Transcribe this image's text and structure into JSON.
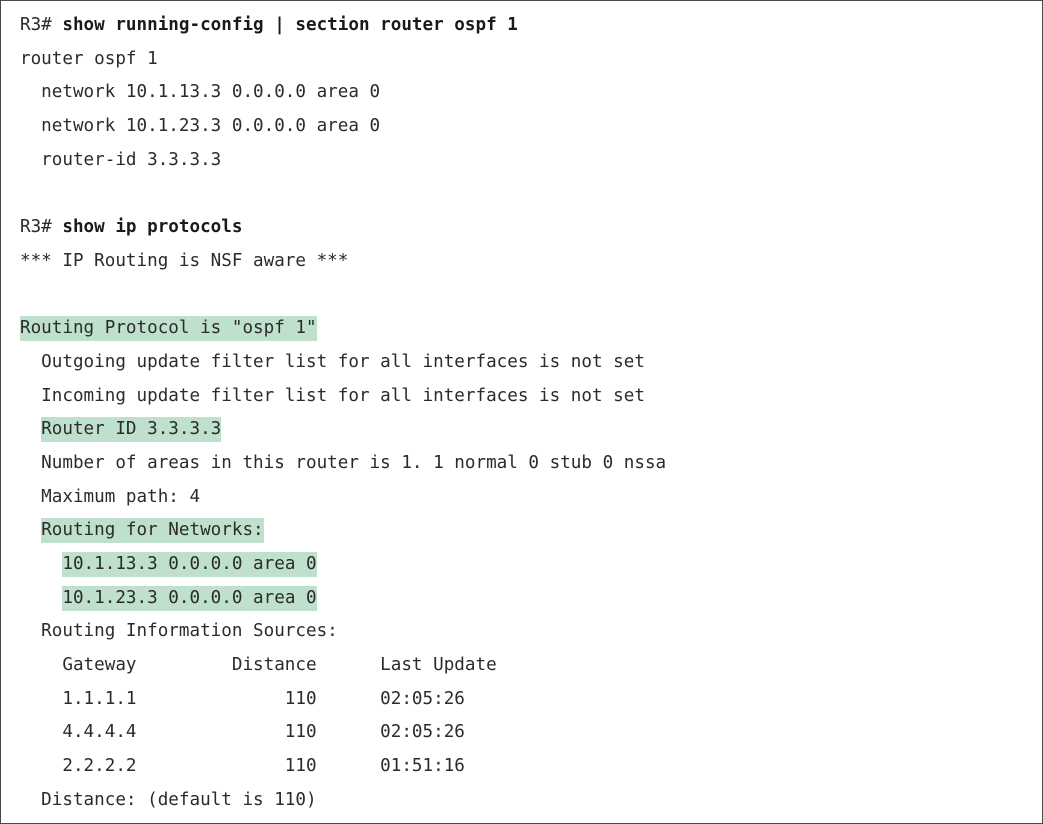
{
  "block1": {
    "prompt": "R3# ",
    "command": "show running-config | section router ospf 1",
    "lines": [
      "router ospf 1",
      "  network 10.1.13.3 0.0.0.0 area 0",
      "  network 10.1.23.3 0.0.0.0 area 0",
      "  router-id 3.3.3.3"
    ]
  },
  "block2": {
    "prompt": "R3# ",
    "command": "show ip protocols",
    "nsf_line": "*** IP Routing is NSF aware ***",
    "routing_protocol": "Routing Protocol is \"ospf 1\"",
    "outgoing_filter": "  Outgoing update filter list for all interfaces is not set",
    "incoming_filter": "  Incoming update filter list for all interfaces is not set",
    "router_id": "Router ID 3.3.3.3",
    "areas": "  Number of areas in this router is 1. 1 normal 0 stub 0 nssa",
    "max_path": "  Maximum path: 4",
    "routing_for_networks": "Routing for Networks:",
    "networks": [
      "10.1.13.3 0.0.0.0 area 0",
      "10.1.23.3 0.0.0.0 area 0"
    ],
    "info_sources": "  Routing Information Sources:",
    "sources_header": "    Gateway         Distance      Last Update",
    "sources": [
      "    1.1.1.1              110      02:05:26",
      "    4.4.4.4              110      02:05:26",
      "    2.2.2.2              110      01:51:16"
    ],
    "distance": "  Distance: (default is 110)"
  }
}
